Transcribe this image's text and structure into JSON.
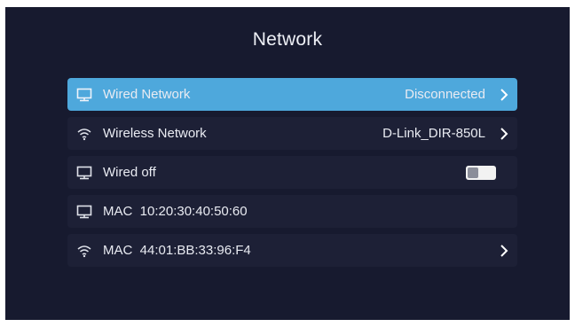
{
  "header": {
    "title": "Network"
  },
  "rows": [
    {
      "icon": "monitor-icon",
      "label": "Wired Network",
      "value": "Disconnected",
      "chevron": true,
      "selected": true
    },
    {
      "icon": "wifi-icon",
      "label": "Wireless Network",
      "value": "D-Link_DIR-850L",
      "chevron": true
    },
    {
      "icon": "monitor-icon",
      "label": "Wired off",
      "toggle": "off"
    },
    {
      "icon": "monitor-icon",
      "label": "MAC  10:20:30:40:50:60"
    },
    {
      "icon": "wifi-icon",
      "label": "MAC  44:01:BB:33:96:F4",
      "chevron": true
    }
  ],
  "colors": {
    "background": "#171a2f",
    "row": "#1d2036",
    "selected": "#4ea8dc",
    "text": "#e9ebf2"
  }
}
